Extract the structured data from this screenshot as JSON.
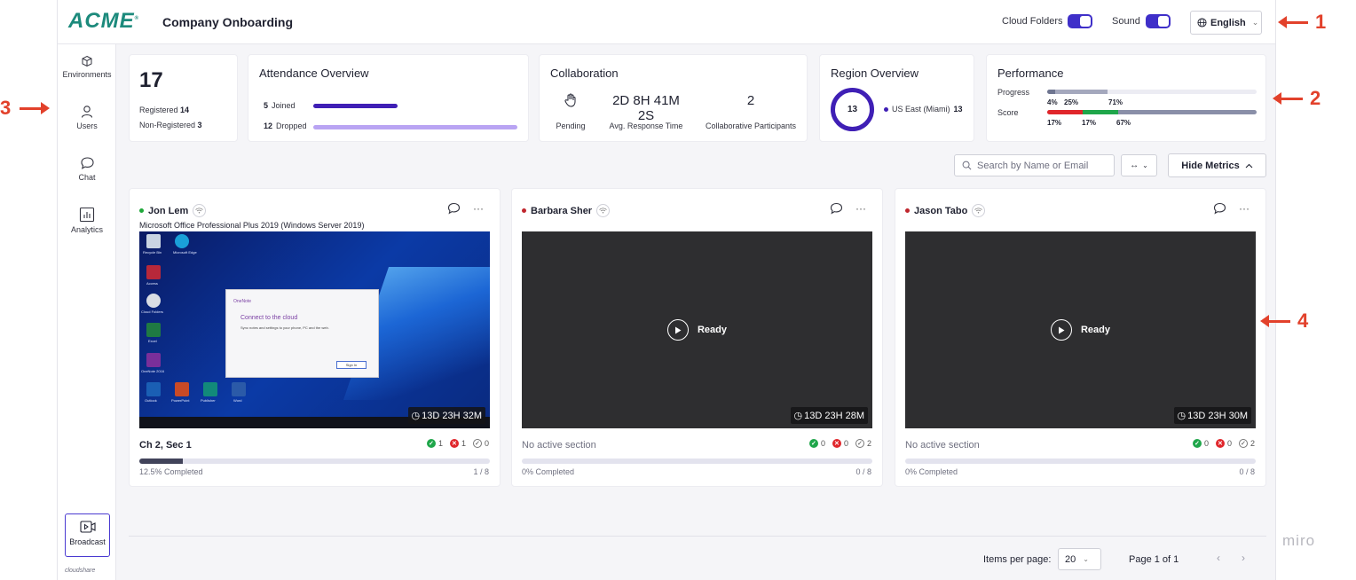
{
  "header": {
    "logo": "ACME",
    "title": "Company Onboarding",
    "cloud_folders_label": "Cloud Folders",
    "sound_label": "Sound",
    "language": "English",
    "accent_color": "#3f2fc9"
  },
  "sidebar": {
    "items": [
      {
        "label": "Environments",
        "icon": "cube-icon"
      },
      {
        "label": "Users",
        "icon": "user-icon"
      },
      {
        "label": "Chat",
        "icon": "chat-bubble-icon"
      },
      {
        "label": "Analytics",
        "icon": "bar-chart-icon"
      }
    ],
    "broadcast_label": "Broadcast",
    "brand": "cloudshare"
  },
  "metrics": {
    "registration": {
      "total": "17",
      "registered_label": "Registered",
      "registered": "14",
      "non_registered_label": "Non-Registered",
      "non_registered": "3"
    },
    "attendance": {
      "title": "Attendance Overview",
      "joined_count": "5",
      "joined_label": "Joined",
      "dropped_count": "12",
      "dropped_label": "Dropped",
      "joined_color": "#3f1fb5",
      "dropped_color": "#b9a4f3"
    },
    "collaboration": {
      "title": "Collaboration",
      "pending_label": "Pending",
      "avg_response_value": "2D 8H 41M 2S",
      "avg_response_label": "Avg. Response Time",
      "participants_value": "2",
      "participants_label": "Collaborative Participants"
    },
    "region": {
      "title": "Region Overview",
      "total": "13",
      "region_name": "US East (Miami)",
      "region_count": "13"
    },
    "performance": {
      "title": "Performance",
      "progress_label": "Progress",
      "progress_values": [
        "4%",
        "25%",
        "71%"
      ],
      "progress_fractions": [
        0.04,
        0.25,
        0.71
      ],
      "score_label": "Score",
      "score_values": [
        "17%",
        "17%",
        "67%"
      ],
      "score_fractions": [
        0.17,
        0.17,
        0.67
      ]
    }
  },
  "toolbar": {
    "search_placeholder": "Search by Name or Email",
    "width_toggle": "↔",
    "hide_metrics_label": "Hide Metrics"
  },
  "users": [
    {
      "name": "Jon Lem",
      "status_color": "#1fa83a",
      "app": "Microsoft Office Professional Plus 2019 (Windows Server 2019)",
      "timer": "13D 23H 32M",
      "section": "Ch 2, Sec 1",
      "passed": "1",
      "failed": "1",
      "pending": "0",
      "completed_text": "12.5% Completed",
      "progress_fraction": 0.125,
      "count": "1 / 8",
      "screen": {
        "desktop_icons": [
          "Recycle Bin",
          "Microsoft Edge",
          "Access",
          "Cloud Folders",
          "Excel",
          "OneNote 2016",
          "Outlook",
          "PowerPoint",
          "Publisher",
          "Word"
        ],
        "dialog_title": "OneNote",
        "dialog_heading": "Connect to the cloud",
        "dialog_text": "Sync notes and settings to your phone, PC and the web.",
        "dialog_button": "Sign In"
      }
    },
    {
      "name": "Barbara Sher",
      "status_color": "#c0262d",
      "ready_label": "Ready",
      "timer": "13D 23H 28M",
      "section": "No active section",
      "passed": "0",
      "failed": "0",
      "pending": "2",
      "completed_text": "0% Completed",
      "progress_fraction": 0,
      "count": "0 / 8"
    },
    {
      "name": "Jason Tabo",
      "status_color": "#c0262d",
      "ready_label": "Ready",
      "timer": "13D 23H 30M",
      "section": "No active section",
      "passed": "0",
      "failed": "0",
      "pending": "2",
      "completed_text": "0% Completed",
      "progress_fraction": 0,
      "count": "0 / 8"
    }
  ],
  "pagination": {
    "items_per_page_label": "Items per page:",
    "items_per_page": "20",
    "page_text": "Page 1 of 1"
  },
  "annotations": [
    "1",
    "2",
    "3",
    "4"
  ],
  "watermark": "miro"
}
